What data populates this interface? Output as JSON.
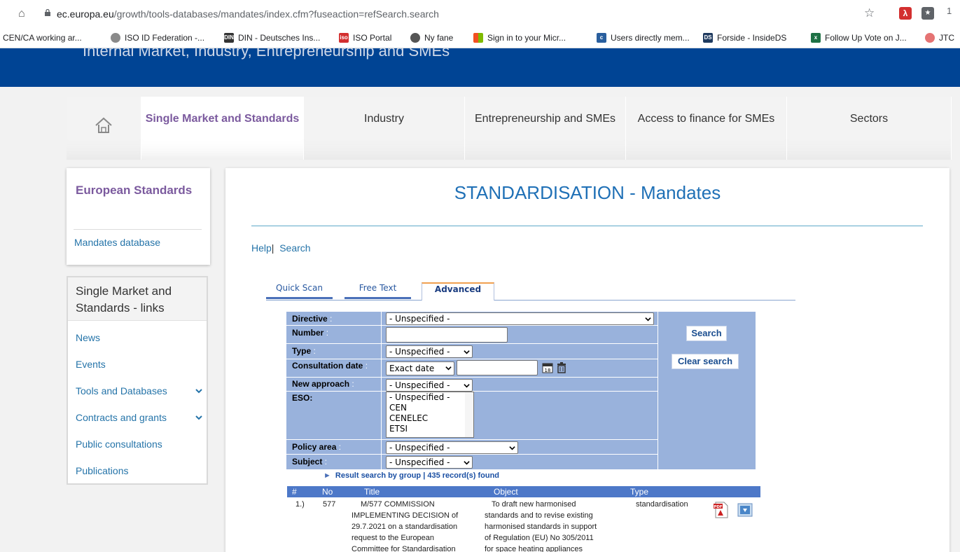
{
  "browser": {
    "url_host": "ec.europa.eu",
    "url_path": "/growth/tools-databases/mandates/index.cfm?fuseaction=refSearch.search",
    "bookmarks": [
      {
        "label": "CEN/CA working ar...",
        "icon": "none"
      },
      {
        "label": "ISO ID Federation -...",
        "icon": "globe-icon"
      },
      {
        "label": "DIN - Deutsches Ins...",
        "icon": "din-icon"
      },
      {
        "label": "ISO Portal",
        "icon": "iso-icon"
      },
      {
        "label": "Ny fane",
        "icon": "globe-icon"
      },
      {
        "label": "Sign in to your Micr...",
        "icon": "microsoft-icon"
      },
      {
        "label": "Users directly mem...",
        "icon": "cen-icon"
      },
      {
        "label": "Forside - InsideDS",
        "icon": "ds-icon"
      },
      {
        "label": "Follow Up Vote on J...",
        "icon": "excel-icon"
      },
      {
        "label": "JTC",
        "icon": "jtc-icon"
      }
    ],
    "ext_label": "1"
  },
  "header": {
    "site_title": "Internal Market, Industry, Entrepreneurship and SMEs"
  },
  "topnav": {
    "items": [
      {
        "label": "Single Market and Standards",
        "active": true
      },
      {
        "label": "Industry",
        "active": false
      },
      {
        "label": "Entrepreneurship and SMEs",
        "active": false
      },
      {
        "label": "Access to finance for SMEs",
        "active": false
      },
      {
        "label": "Sectors",
        "active": false
      }
    ]
  },
  "sidebar": {
    "section_title": "European Standards",
    "section_link": "Mandates database",
    "links_title": "Single Market and Standards - links",
    "links": [
      {
        "label": "News",
        "expandable": false
      },
      {
        "label": "Events",
        "expandable": false
      },
      {
        "label": "Tools and Databases",
        "expandable": true
      },
      {
        "label": "Contracts and grants",
        "expandable": true
      },
      {
        "label": "Public consultations",
        "expandable": false
      },
      {
        "label": "Publications",
        "expandable": false
      }
    ]
  },
  "main": {
    "title": "STANDARDISATION - Mandates",
    "help_label": "Help",
    "separator": "|",
    "search_label": "Search",
    "tabs": [
      "Quick Scan",
      "Free Text",
      "Advanced"
    ],
    "form": {
      "directive_label": "Directive",
      "directive_value": "- Unspecified -",
      "number_label": "Number",
      "number_value": "",
      "type_label": "Type",
      "type_value": "- Unspecified -",
      "consultation_label": "Consultation date",
      "consultation_mode": "Exact date",
      "consultation_value": "",
      "new_approach_label": "New approach",
      "new_approach_value": "- Unspecified -",
      "eso_label": "ESO:",
      "eso_options": [
        "- Unspecified -",
        "CEN",
        "CENELEC",
        "ETSI"
      ],
      "policy_label": "Policy area",
      "policy_value": "- Unspecified -",
      "subject_label": "Subject",
      "subject_value": "- Unspecified -",
      "colon": ":",
      "search_button": "Search",
      "clear_button": "Clear search"
    },
    "result_summary": "Result search by group | 435 record(s) found",
    "results": {
      "columns": [
        "#",
        "No",
        "Title",
        "Object",
        "Type"
      ],
      "rows": [
        {
          "index": "1.)",
          "no": "577",
          "title_lines": [
            "M/577 COMMISSION",
            "IMPLEMENTING DECISION of",
            "29.7.2021 on a standardisation",
            "request to the European",
            "Committee for Standardisation"
          ],
          "object_lines": [
            "To draft new harmonised",
            "standards and to revise existing",
            "harmonised standards in support",
            "of Regulation (EU) No 305/2011",
            "for space heating appliances"
          ],
          "type": "standardisation"
        }
      ]
    }
  },
  "colors": {
    "ec_blue": "#004494",
    "form_bg": "#99b2dc",
    "table_head": "#4d78c8",
    "title_blue": "#1f70b6",
    "link_blue": "#2574a9",
    "purple": "#7b5a9e"
  }
}
